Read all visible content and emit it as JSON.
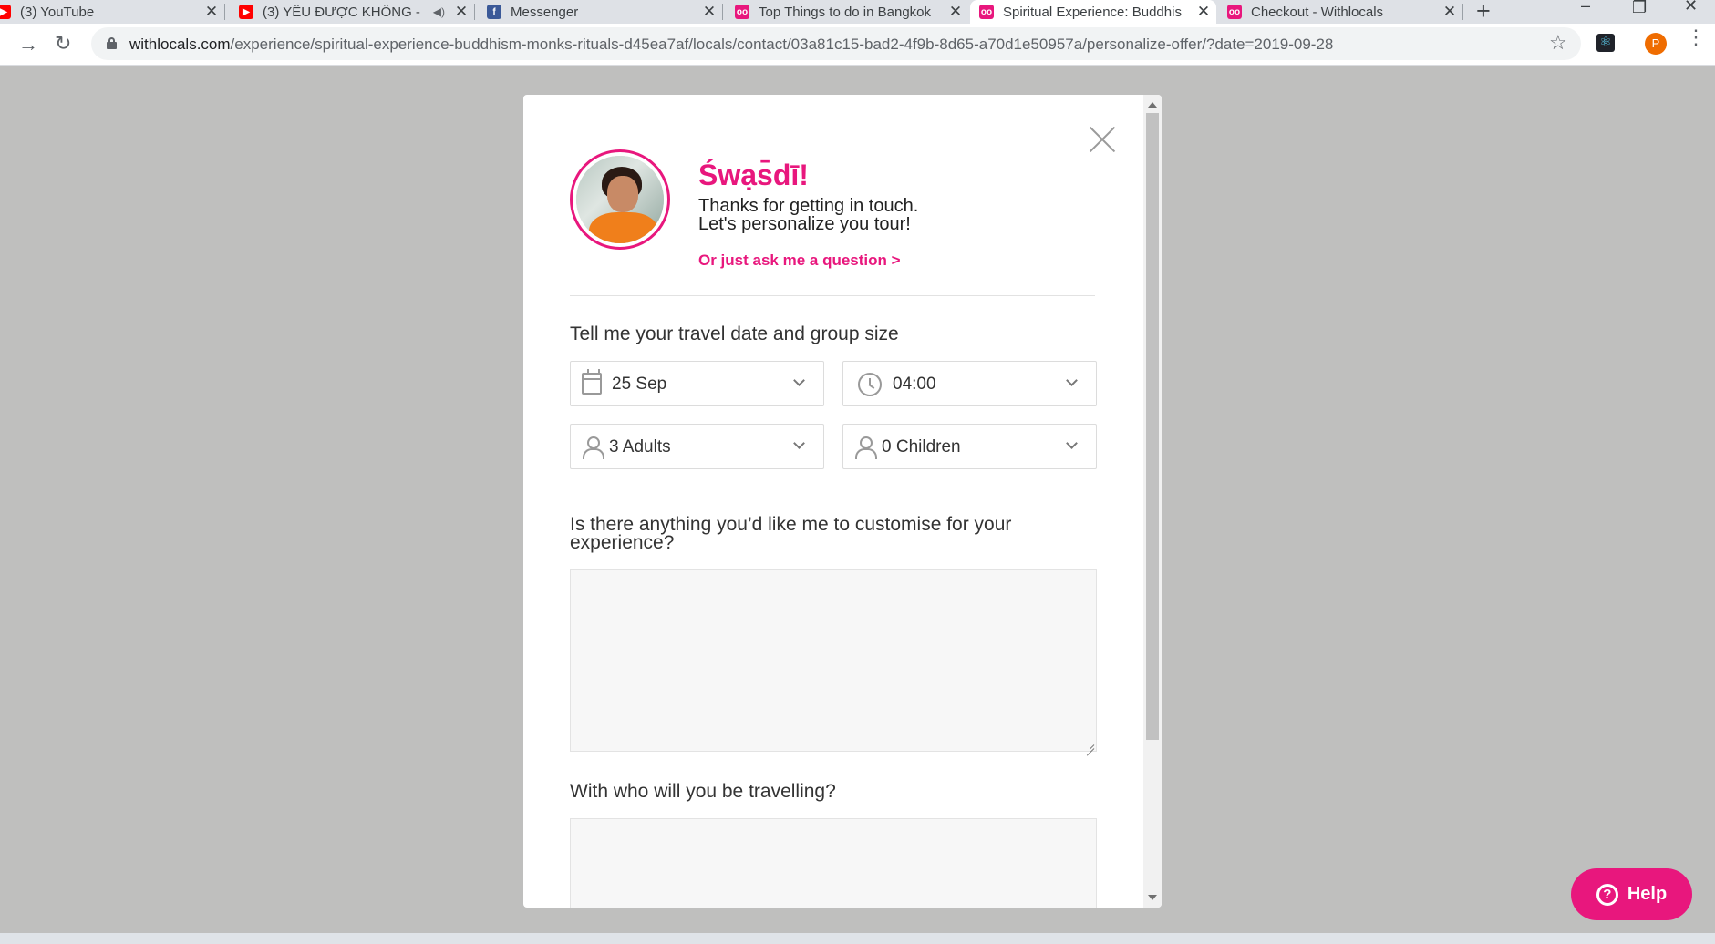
{
  "browser": {
    "tabs": [
      {
        "title": "(3) YouTube",
        "favicon": "youtube-icon"
      },
      {
        "title": "(3) YÊU ĐƯỢC KHÔNG -",
        "favicon": "youtube-icon",
        "audio": "speaker-icon"
      },
      {
        "title": "Messenger",
        "favicon": "facebook-icon"
      },
      {
        "title": "Top Things to do in Bangkok",
        "favicon": "withlocals-icon"
      },
      {
        "title": "Spiritual Experience: Buddhis",
        "favicon": "withlocals-icon",
        "active": true
      },
      {
        "title": "Checkout - Withlocals",
        "favicon": "withlocals-icon"
      }
    ],
    "tab_close_glyph": "✕",
    "url_host": "withlocals.com",
    "url_path": "/experience/spiritual-experience-buddhism-monks-rituals-d45ea7af/locals/contact/03a81c15-bad2-4f9b-8d65-a70d1e50957a/personalize-offer/?date=2019-09-28",
    "profile_initial": "P"
  },
  "modal": {
    "greeting": "Śwạs̄dī!",
    "intro_line1": "Thanks for getting in touch.",
    "intro_line2": "Let's personalize you tour!",
    "ask_link": "Or just ask me a question >",
    "travel_label": "Tell me your travel date and group size",
    "date_value": "25 Sep",
    "time_value": "04:00",
    "adults_value": "3 Adults",
    "children_value": "0 Children",
    "customise_label_line1": "Is there anything you’d like me to customise for your",
    "customise_label_line2": "experience?",
    "companions_label": "With who will you be travelling?"
  },
  "help": {
    "label": "Help"
  },
  "colors": {
    "accent": "#e8177d",
    "overlay": "#bfbfbe"
  }
}
